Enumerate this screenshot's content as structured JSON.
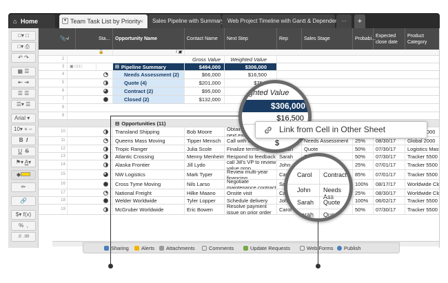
{
  "tabs": {
    "home": "Home",
    "active": "Team Task List by Priority",
    "tab3": "Sales Pipeline with Summary",
    "tab4": "Web Project Timeline with Gantt & Dependencies",
    "more": "···",
    "plus": "+"
  },
  "toolbar": {
    "font": "Arial",
    "size": "10",
    "bold": "B",
    "italic": "I",
    "underline": "U",
    "strike": "S",
    "dollar": "$",
    "formula": "f(x)",
    "percent": "%"
  },
  "headers": {
    "status": "Sta...",
    "opportunity": "Opportunity Name",
    "contact": "Contact Name",
    "next_step": "Next Step",
    "rep": "Rep",
    "sales_stage": "Sales Stage",
    "probability": "Probabi...",
    "close_date": "Expected close date",
    "product": "Product Category",
    "info": "i"
  },
  "summary_labels": {
    "gross": "Gross Value",
    "weighted": "Weighted Value"
  },
  "summary": {
    "title": "Pipeline Summary",
    "title_gross": "$494,000",
    "title_weighted": "$306,000",
    "items": [
      {
        "label": "Needs Assessment (2)",
        "gross": "$66,000",
        "weighted": "$16,500"
      },
      {
        "label": "Quote (4)",
        "gross": "$201,000",
        "weighted": "$76,2"
      },
      {
        "label": "Contract (2)",
        "gross": "$95,000",
        "weighted": ""
      },
      {
        "label": "Closed (2)",
        "gross": "$132,000",
        "weighted": ""
      }
    ]
  },
  "group": {
    "label": "Opportunities (11)"
  },
  "rows": [
    {
      "num": "10",
      "opp": "Transland Shipping",
      "contact": "Bob Moore",
      "next": "Obtain signature on next exec m...",
      "rep": "",
      "stage": "Needs Assessment",
      "prob": "25%",
      "date": "08/30/17",
      "product": "Global 2000"
    },
    {
      "num": "11",
      "opp": "Queens Mass Moving",
      "contact": "Tipper Mensch",
      "next": "Call with verbal c...",
      "rep": "",
      "stage": "Needs Assessment",
      "prob": "25%",
      "date": "08/30/17",
      "product": "Global 2000"
    },
    {
      "num": "12",
      "opp": "Tropic Ranger",
      "contact": "Julia Scole",
      "next": "Finalize terms",
      "rep": "Sarah",
      "stage": "Quote",
      "prob": "50%",
      "date": "07/30/17",
      "product": "Logistics Master"
    },
    {
      "num": "13",
      "opp": "Atlantic Crossing",
      "contact": "Menny Menheim",
      "next": "Respond to feedback",
      "rep": "Sarah",
      "stage": "Quote",
      "prob": "50%",
      "date": "07/30/17",
      "product": "Tracker 5500"
    },
    {
      "num": "14",
      "opp": "Alaska Frontier",
      "contact": "Jill Lydo",
      "next": "call Jill's VP to review value prop",
      "rep": "John",
      "stage": "",
      "prob": "25%",
      "date": "07/01/17",
      "product": "Tracker 5500"
    },
    {
      "num": "15",
      "opp": "NW Logistics",
      "contact": "Mark Typer",
      "next": "Review multi-year financing",
      "rep": "Carol",
      "stage": "",
      "prob": "85%",
      "date": "07/01/17",
      "product": "Tracker 5500"
    },
    {
      "num": "16",
      "opp": "Cross Tyme Moving",
      "contact": "Nils Larso",
      "next": "Negotiate maintenance contract",
      "rep": "Sa",
      "stage": "",
      "prob": "100%",
      "date": "08/17/17",
      "product": "Worldwide Close"
    },
    {
      "num": "17",
      "opp": "National Freight",
      "contact": "Hilke Maano",
      "next": "Onsite visit",
      "rep": "Carol",
      "stage": "",
      "prob": "25%",
      "date": "08/30/17",
      "product": "Worldwide Close"
    },
    {
      "num": "18",
      "opp": "Welder Worldwide",
      "contact": "Tyler Lopper",
      "next": "Schedule delivery",
      "rep": "John",
      "stage": "",
      "prob": "100%",
      "date": "06/02/17",
      "product": "Tracker 5500"
    },
    {
      "num": "19",
      "opp": "McGruber Worldwide",
      "contact": "Eric Bowen",
      "next": "Resolve payment issue on prior order",
      "rep": "Carol",
      "stage": "Quote",
      "prob": "50%",
      "date": "07/30/17",
      "product": "Tracker 5500"
    }
  ],
  "blank_rows": [
    "2",
    "3",
    "4",
    "5",
    "6",
    "7",
    "8",
    "9"
  ],
  "magnifier_left": {
    "weighted_title": "ghted Value",
    "weighted_top": "$306,000",
    "weighted_next": "$16,500",
    "d1": "$",
    "d2": "$"
  },
  "magnifier_right": {
    "rows": [
      [
        "Carol",
        "Contract"
      ],
      [
        "John",
        "Needs Ass"
      ],
      [
        "Sarah",
        "Quote"
      ],
      [
        "Sarah",
        "Quote"
      ]
    ]
  },
  "tooltip": {
    "text": "Link from Cell in Other Sheet"
  },
  "bottom_tabs": [
    "Sharing",
    "Alerts",
    "Attachments",
    "Comments",
    "Update Requests",
    "Web Forms",
    "Publish"
  ]
}
